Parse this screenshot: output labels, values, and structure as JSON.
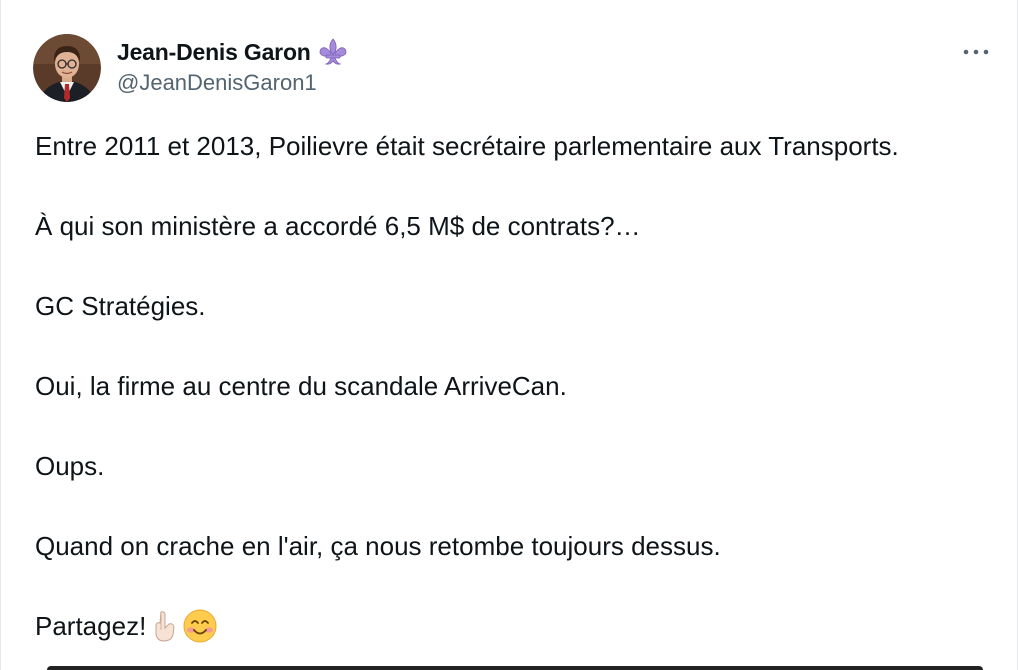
{
  "author": {
    "display_name": "Jean-Denis Garon",
    "handle": "@JeanDenisGaron1",
    "badge_icon": "fleur-de-lis-icon",
    "badge_color": "#a78bdb"
  },
  "more_icon": "more-horizontal-icon",
  "tweet": {
    "lines": [
      "Entre 2011 et 2013, Poilievre était secrétaire parlementaire aux Transports.",
      "À qui son ministère a accordé 6,5 M$ de contrats?…",
      "GC Stratégies.",
      "Oui, la firme au centre du scandale ArriveCan.",
      "Oups.",
      "Quand on crache en l'air, ça nous retombe toujours dessus.",
      "Partagez!"
    ],
    "trailing_emojis": [
      "pointing-down-emoji",
      "smiling-face-emoji"
    ]
  },
  "colors": {
    "text": "#0f1419",
    "secondary_text": "#536471",
    "border": "#e6e9ec"
  }
}
